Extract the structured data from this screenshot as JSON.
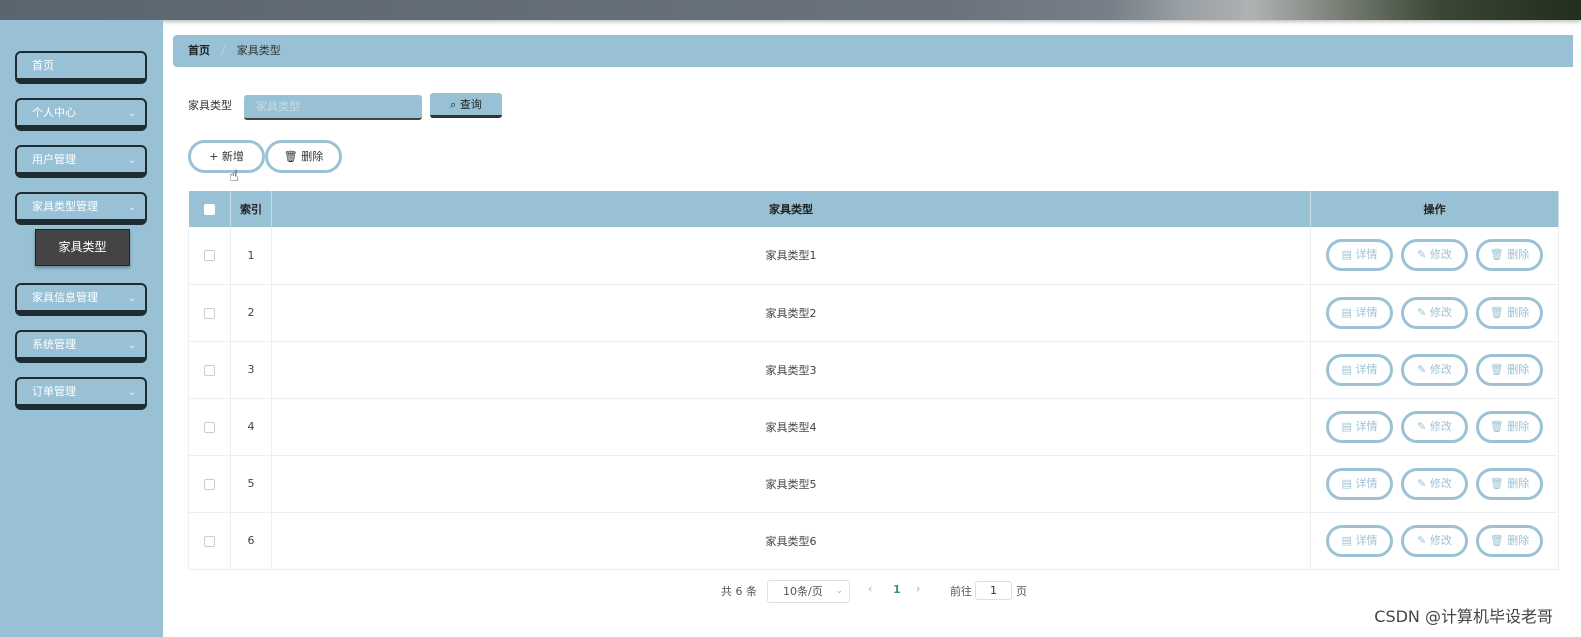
{
  "sidebar": {
    "items": [
      {
        "label": "首页",
        "has_children": false
      },
      {
        "label": "个人中心",
        "has_children": true
      },
      {
        "label": "用户管理",
        "has_children": true
      },
      {
        "label": "家具类型管理",
        "has_children": true
      },
      {
        "label": "家具信息管理",
        "has_children": true
      },
      {
        "label": "系统管理",
        "has_children": true
      },
      {
        "label": "订单管理",
        "has_children": true
      }
    ],
    "active_sub_item": "家具类型"
  },
  "breadcrumb": {
    "home": "首页",
    "separator": "/",
    "current": "家具类型"
  },
  "search": {
    "label": "家具类型",
    "placeholder": "家具类型",
    "value": "",
    "button_label": "查询",
    "button_icon": "search-icon"
  },
  "actions": {
    "add_label": "新增",
    "add_icon": "plus-icon",
    "delete_label": "删除",
    "delete_icon": "trash-icon"
  },
  "table": {
    "headers": {
      "index": "索引",
      "type": "家具类型",
      "ops": "操作"
    },
    "rows": [
      {
        "index": "1",
        "type": "家具类型1"
      },
      {
        "index": "2",
        "type": "家具类型2"
      },
      {
        "index": "3",
        "type": "家具类型3"
      },
      {
        "index": "4",
        "type": "家具类型4"
      },
      {
        "index": "5",
        "type": "家具类型5"
      },
      {
        "index": "6",
        "type": "家具类型6"
      }
    ],
    "row_ops": {
      "detail": "详情",
      "edit": "修改",
      "delete": "删除"
    }
  },
  "pagination": {
    "total_text": "共 6 条",
    "page_size": "10条/页",
    "current_page": "1",
    "goto_label": "前往",
    "goto_value": "1",
    "page_unit": "页"
  },
  "watermark": "CSDN @计算机毕设老哥",
  "colors": {
    "accent": "#98c1d5",
    "pill_border": "#9cc3d5",
    "active_page": "#2e9b6e",
    "submenu_bg": "#444444"
  }
}
